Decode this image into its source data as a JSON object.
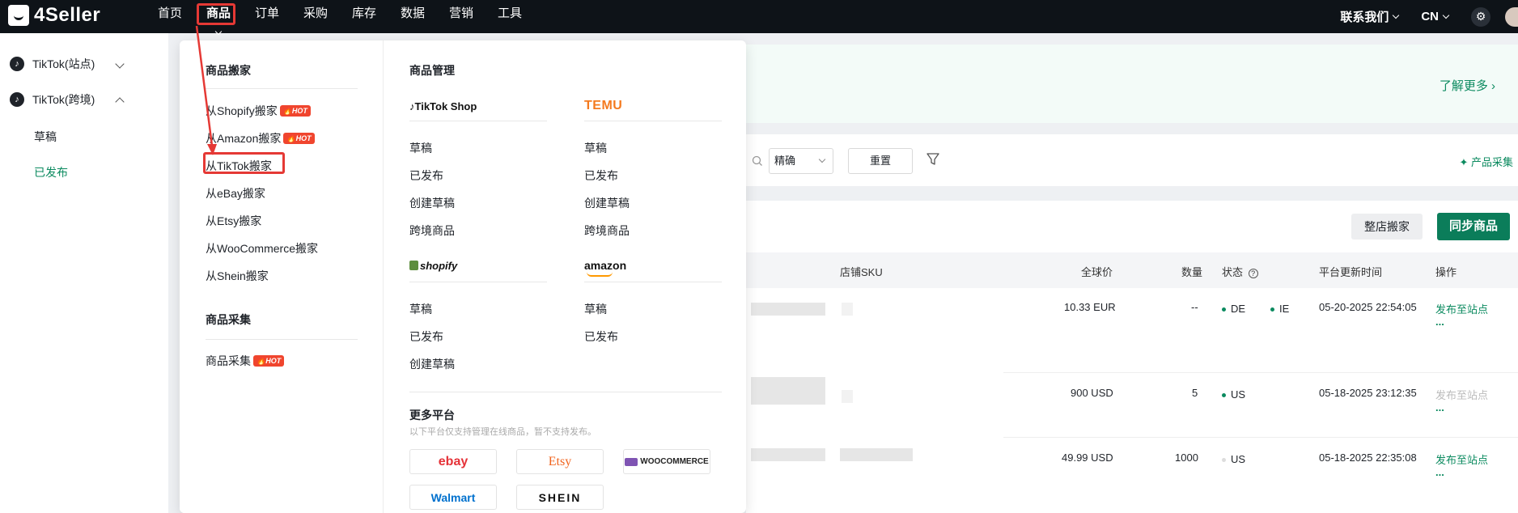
{
  "app": {
    "logo_text": "4Seller"
  },
  "nav": {
    "items": [
      "首页",
      "商品",
      "订单",
      "采购",
      "库存",
      "数据",
      "营销",
      "工具"
    ],
    "active_index": 1
  },
  "top_right": {
    "contact": "联系我们",
    "lang": "CN"
  },
  "sidebar": {
    "groups": [
      {
        "label": "TikTok(站点)",
        "expanded": false
      },
      {
        "label": "TikTok(跨境)",
        "expanded": true
      }
    ],
    "sub_items": [
      "草稿",
      "已发布"
    ],
    "active_sub": "已发布"
  },
  "banner": {
    "learn_more": "了解更多 ›"
  },
  "filters": {
    "match_mode": "精确",
    "reset_label": "重置",
    "collect_label": "产品采集"
  },
  "actions": {
    "store_move": "整店搬家",
    "sync": "同步商品"
  },
  "table": {
    "headers": {
      "sku": "店铺SKU",
      "price": "全球价",
      "qty": "数量",
      "status": "状态",
      "time": "平台更新时间",
      "op": "操作"
    },
    "rows": [
      {
        "price": "10.33 EUR",
        "qty": "--",
        "status": [
          "DE",
          "IE"
        ],
        "time": "05-20-2025 22:54:05",
        "op": "发布至站点",
        "more": "...",
        "op_enabled": true
      },
      {
        "price": "900 USD",
        "qty": "5",
        "status": [
          "US"
        ],
        "time": "05-18-2025 23:12:35",
        "op": "发布至站点",
        "more": "...",
        "op_enabled": false
      },
      {
        "price": "49.99 USD",
        "qty": "1000",
        "status": [
          "US"
        ],
        "time": "05-18-2025 22:35:08",
        "op": "发布至站点",
        "more": "...",
        "op_enabled": true
      }
    ]
  },
  "dropdown": {
    "move": {
      "title": "商品搬家",
      "items": [
        {
          "label": "从Shopify搬家",
          "hot": true
        },
        {
          "label": "从Amazon搬家",
          "hot": true
        },
        {
          "label": "从TikTok搬家",
          "hot": false
        },
        {
          "label": "从eBay搬家",
          "hot": false
        },
        {
          "label": "从Etsy搬家",
          "hot": false
        },
        {
          "label": "从WooCommerce搬家",
          "hot": false
        },
        {
          "label": "从Shein搬家",
          "hot": false
        }
      ]
    },
    "collect": {
      "title": "商品采集",
      "items": [
        {
          "label": "商品采集",
          "hot": true
        }
      ]
    },
    "hot_label": "HOT",
    "manage": {
      "title": "商品管理",
      "tiktok": {
        "logo": "TikTok Shop",
        "items": [
          "草稿",
          "已发布",
          "创建草稿",
          "跨境商品"
        ]
      },
      "temu": {
        "logo": "TEMU",
        "items": [
          "草稿",
          "已发布",
          "创建草稿",
          "跨境商品"
        ]
      },
      "shopify": {
        "logo": "shopify",
        "items": [
          "草稿",
          "已发布",
          "创建草稿"
        ]
      },
      "amazon": {
        "logo": "amazon",
        "items": [
          "草稿",
          "已发布"
        ]
      }
    },
    "more": {
      "title": "更多平台",
      "note": "以下平台仅支持管理在线商品，暂不支持发布。",
      "platforms": [
        "ebay",
        "Etsy",
        "WOOCOMMERCE",
        "Walmart",
        "SHEIN"
      ]
    }
  },
  "colors": {
    "brand_green": "#0b8a5f",
    "highlight_red": "#e53935",
    "hot_red": "#f0452e",
    "topbar": "#0e1318"
  }
}
